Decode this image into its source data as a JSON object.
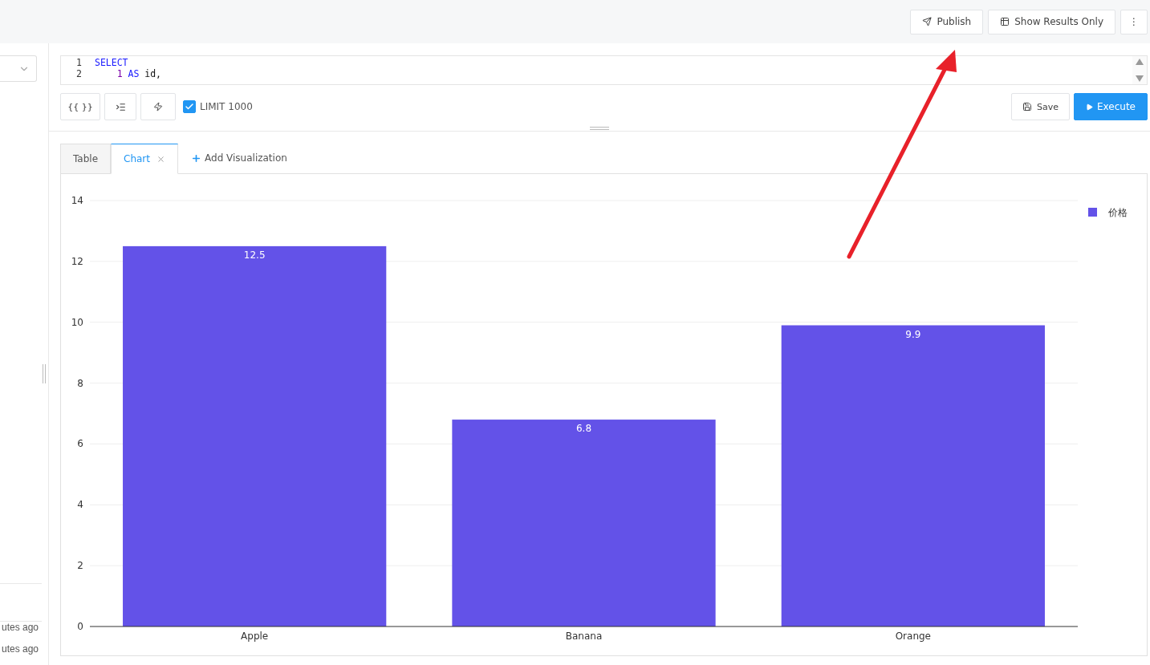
{
  "header": {
    "buttons": [
      {
        "kind": "publish",
        "label": "Publish"
      },
      {
        "kind": "results",
        "label": "Show Results Only"
      },
      {
        "kind": "more",
        "label": "⋮"
      }
    ]
  },
  "sidebar": {
    "recent": [
      {
        "time": "utes ago"
      },
      {
        "time": "utes ago"
      }
    ]
  },
  "editor": {
    "lines": [
      {
        "number": "1",
        "indent": false,
        "tokens": [
          {
            "kind": "keyword",
            "text": "SELECT"
          }
        ]
      },
      {
        "number": "2",
        "indent": true,
        "tokens": [
          {
            "kind": "number",
            "text": "1"
          },
          {
            "kind": "keyword",
            "text": "AS"
          },
          {
            "kind": "plain",
            "text": "id,"
          }
        ]
      }
    ]
  },
  "toolbar": {
    "buttons": [
      {
        "kind": "params",
        "label": "{{ }}"
      },
      {
        "kind": "indent"
      },
      {
        "kind": "bolt"
      }
    ],
    "limit": {
      "label": "LIMIT 1000",
      "checked": true
    },
    "save": "Save",
    "execute": "Execute"
  },
  "tabs": [
    {
      "label": "Table",
      "selected": false,
      "closable": false
    },
    {
      "label": "Chart",
      "selected": true,
      "closable": true
    }
  ],
  "add_visualization": "Add Visualization",
  "chart": {
    "chart_data": {
      "type": "bar",
      "categories": [
        "Apple",
        "Banana",
        "Orange"
      ],
      "series": [
        {
          "name": "价格",
          "color": "#6352e8",
          "values": [
            12.5,
            6.8,
            9.9
          ]
        }
      ],
      "ylim": [
        0,
        14
      ],
      "grid": true,
      "yticks": [
        0,
        2,
        4,
        6,
        8,
        10,
        12,
        14
      ],
      "data_labels": true
    }
  }
}
